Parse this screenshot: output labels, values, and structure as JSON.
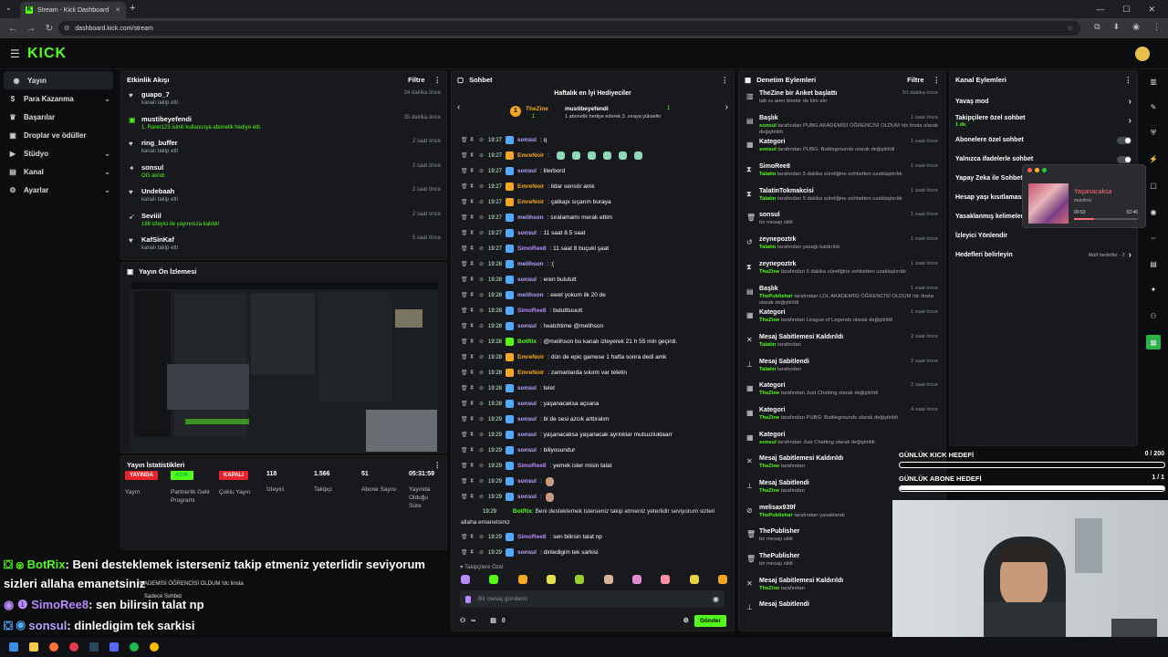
{
  "browser": {
    "tab_title": "Stream - Kick Dashboard",
    "url": "dashboard.kick.com/stream"
  },
  "brand": {
    "logo": "KICK",
    "accent": "#53fc18"
  },
  "sidebar": {
    "items": [
      {
        "label": "Yayın",
        "icon": "broadcast-icon",
        "active": true
      },
      {
        "label": "Para Kazanma",
        "icon": "dollar-icon",
        "chevron": true
      },
      {
        "label": "Başarılar",
        "icon": "trophy-icon"
      },
      {
        "label": "Droplar ve ödüller",
        "icon": "gift-icon"
      },
      {
        "label": "Stüdyo",
        "icon": "studio-icon",
        "chevron": true
      },
      {
        "label": "Kanal",
        "icon": "channel-icon",
        "chevron": true
      },
      {
        "label": "Ayarlar",
        "icon": "gear-icon",
        "chevron": true
      }
    ]
  },
  "activity": {
    "title": "Etkinlik Akışı",
    "filter": "Filtre",
    "items": [
      {
        "name": "guapo_7",
        "desc": "kanalı takip etti",
        "time": "34 dakika önce",
        "icon": "heart-icon",
        "green": false
      },
      {
        "name": "mustibeyefendi",
        "desc": "1. Rarer123 isimli kullanıcıya abonelik hediye etti.",
        "time": "35 dakika önce",
        "icon": "gift-icon",
        "green": true
      },
      {
        "name": "ring_buffer",
        "desc": "kanalı takip etti",
        "time": "2 saat önce",
        "icon": "heart-icon",
        "green": false
      },
      {
        "name": "sonsul",
        "desc": "OG alındı",
        "time": "2 saat önce",
        "icon": "drop-icon",
        "green": true
      },
      {
        "name": "Undebaah",
        "desc": "kanalı takip etti",
        "time": "2 saat önce",
        "icon": "heart-icon",
        "green": false
      },
      {
        "name": "Seviiil",
        "desc": "188 izleyici ile yayınınıza katıldı!",
        "time": "2 saat önce",
        "icon": "raid-icon",
        "green": true
      },
      {
        "name": "KafSinKaf",
        "desc": "kanalı takip etti",
        "time": "5 saat önce",
        "icon": "heart-icon",
        "green": false
      }
    ]
  },
  "preview": {
    "title": "Yayın Ön İzlemesi"
  },
  "stats": {
    "title": "Yayın İstatistikleri",
    "items": [
      {
        "value": "YAYINDA",
        "label": "Yayın",
        "pill_color": "#e8242c"
      },
      {
        "value": "ACIK",
        "label": "Partnerlik Gelir Programı",
        "pill_color": "#53fc18"
      },
      {
        "value": "KAPALI",
        "label": "Çoklu Yayın",
        "pill_color": "#e8242c"
      },
      {
        "value": "118",
        "label": "İzleyici"
      },
      {
        "value": "1.566",
        "label": "Takipçi"
      },
      {
        "value": "51",
        "label": "Abone Sayısı"
      },
      {
        "value": "05:31:59",
        "label": "Yayında Olduğu Süre"
      }
    ]
  },
  "chat": {
    "title": "Sohbet",
    "gifters_title": "Haftalık en İyi Hediyeciler",
    "top_gifter": {
      "name": "TheZine",
      "count": "1",
      "sub": "1"
    },
    "top_gifter2": {
      "name": "mustibeyefendi",
      "count": "1",
      "desc": "1 abonelik hediye ederek 3. sıraya yükselin"
    },
    "messages": [
      {
        "time": "19:27",
        "user": "sonsul",
        "color": "#b7a4ff",
        "text": "q"
      },
      {
        "time": "19:27",
        "user": "EmreNoir",
        "color": "#f5a623",
        "text": ""
      },
      {
        "time": "19:27",
        "user": "sonsul",
        "color": "#b7a4ff",
        "text": "literbord"
      },
      {
        "time": "19:27",
        "user": "EmreNoir",
        "color": "#f5a623",
        "text": "ildar sensör amk"
      },
      {
        "time": "19:27",
        "user": "EmreNoir",
        "color": "#f5a623",
        "text": "çatkapı sıçarım buraya"
      },
      {
        "time": "19:27",
        "user": "melihson",
        "color": "#b7a4ff",
        "text": "sıralamamı merak ettim"
      },
      {
        "time": "19:27",
        "user": "sonsul",
        "color": "#b7a4ff",
        "text": "11 saat 8.5 saat"
      },
      {
        "time": "19:27",
        "user": "SimoRee8",
        "color": "#b98bff",
        "text": "11 saat 8 buçukl şaat"
      },
      {
        "time": "19:28",
        "user": "melihson",
        "color": "#b7a4ff",
        "text": ":("
      },
      {
        "time": "19:28",
        "user": "sonsul",
        "color": "#b7a4ff",
        "text": "eren bulututt"
      },
      {
        "time": "19:28",
        "user": "melihson",
        "color": "#b7a4ff",
        "text": "ewet yokum ilk 20 de"
      },
      {
        "time": "19:28",
        "user": "SimoRee8",
        "color": "#b98bff",
        "text": "bulutttuuutt"
      },
      {
        "time": "19:28",
        "user": "sonsul",
        "color": "#b7a4ff",
        "text": "!watchtime @melihson"
      },
      {
        "time": "19:28",
        "user": "BotRix",
        "color": "#53fc18",
        "text": "@melihson bu kanalı izleyerek 21 h 55 min geçirdi."
      },
      {
        "time": "19:28",
        "user": "EmreNoir",
        "color": "#f5a623",
        "text": "dün de epic gamese 1 hafta sonra dedi amk"
      },
      {
        "time": "19:28",
        "user": "EmreNoir",
        "color": "#f5a623",
        "text": "zamanlarda sıkıntı var teletin"
      },
      {
        "time": "19:28",
        "user": "sonsul",
        "color": "#b7a4ff",
        "text": "telet"
      },
      {
        "time": "19:28",
        "user": "sonsul",
        "color": "#b7a4ff",
        "text": "yaşanacaksa açsana"
      },
      {
        "time": "19:29",
        "user": "sonsul",
        "color": "#b7a4ff",
        "text": "bi de sesi azcık arttıralım"
      },
      {
        "time": "19:29",
        "user": "sonsul",
        "color": "#b7a4ff",
        "text": "yaşanacaksa yaşanacak ayrılıklar mutsuzluklaarr"
      },
      {
        "time": "19:29",
        "user": "sonsul",
        "color": "#b7a4ff",
        "text": "biliyosundur"
      },
      {
        "time": "19:29",
        "user": "SimoRee8",
        "color": "#b98bff",
        "text": "yemek ister misin talat"
      },
      {
        "time": "19:29",
        "user": "sonsul",
        "color": "#b7a4ff",
        "text": ""
      },
      {
        "time": "19:29",
        "user": "sonsul",
        "color": "#b7a4ff",
        "text": ""
      }
    ],
    "botrix_long": {
      "time": "19:29",
      "user": "BotRix",
      "text": "Beni desteklemek isterseniz takip etmeniz yeterlidir seviyorum sizleri allaha emanetsiniz"
    },
    "tail": [
      {
        "time": "19:29",
        "user": "SimoRee8",
        "color": "#b98bff",
        "text": "sen bilirsin talat np"
      },
      {
        "time": "19:29",
        "user": "sonsul",
        "color": "#b7a4ff",
        "text": "dinledigim tek sarkisi"
      }
    ],
    "followers_only": "Takipçilere Özel",
    "placeholder": "Bir mesaj gönderin",
    "send": "Gönder",
    "counter_inf": "∞",
    "counter_zero": "0"
  },
  "moderation": {
    "title": "Denetim Eylemleri",
    "filter": "Filtre",
    "items": [
      {
        "title": "TheZine bir Anket başlattı",
        "desc": "talt vs aren birebir de kim alır",
        "time": "50 dakika önce",
        "icon": "poll-icon"
      },
      {
        "title": "Başlık",
        "who": "sonsul",
        "desc": "tarafından PUBG AKADEMİSİ ÖĞRENCİSİ OLDUM !dc linsta olarak değiştirildi",
        "time": "1 saat önce",
        "icon": "title-icon"
      },
      {
        "title": "Kategori",
        "who": "sonsul",
        "desc": "tarafından PUBG: Battlegrounds olarak değiştirildi",
        "time": "1 saat önce",
        "icon": "category-icon"
      },
      {
        "title": "SimoRee8",
        "who": "Talatin",
        "desc": "tarafından 5 dakika süreliğine sohbetten uzaklaştırıldı",
        "time": "1 saat önce",
        "icon": "timeout-icon"
      },
      {
        "title": "TalatinTokmakcisi",
        "who": "Talatin",
        "desc": "tarafından 5 dakika süreliğine sohbetten uzaklaştırıldı",
        "time": "1 saat önce",
        "icon": "timeout-icon"
      },
      {
        "title": "sonsul",
        "desc": "bir mesajı sildi",
        "time": "1 saat önce",
        "icon": "trash-icon"
      },
      {
        "title": "zeynepoztrk",
        "who": "Talatin",
        "desc": "tarafından yasağı kaldırıldı",
        "time": "1 saat önce",
        "icon": "unban-icon"
      },
      {
        "title": "zeynepoztrk",
        "who": "TheZine",
        "desc": "tarafından 5 dakika süreliğine sohbetten uzaklaştırıldı",
        "time": "1 saat önce",
        "icon": "timeout-icon"
      },
      {
        "title": "Başlık",
        "who": "ThePublisher",
        "desc": "tarafından LOL AKADEMİSİ ÖĞRENCİSİ OLDUM !dc linsta olarak değiştirildi",
        "time": "1 saat önce",
        "icon": "title-icon"
      },
      {
        "title": "Kategori",
        "who": "TheZine",
        "desc": "tarafından League of Legends olarak değiştirildi",
        "time": "1 saat önce",
        "icon": "category-icon"
      },
      {
        "title": "Mesaj Sabitlemesi Kaldırıldı",
        "who": "Talatin",
        "desc": "tarafından",
        "time": "2 saat önce",
        "icon": "unpin-icon"
      },
      {
        "title": "Mesaj Sabitlendi",
        "who": "Talatin",
        "desc": "tarafından",
        "time": "2 saat önce",
        "icon": "pin-icon"
      },
      {
        "title": "Kategori",
        "who": "TheZine",
        "desc": "tarafından Just Chatting olarak değiştirildi",
        "time": "2 saat önce",
        "icon": "category-icon"
      },
      {
        "title": "Kategori",
        "who": "TheZine",
        "desc": "tarafından PUBG: Battlegrounds olarak değiştirildi",
        "time": "4 saat önce",
        "icon": "category-icon"
      },
      {
        "title": "Kategori",
        "who": "sonsul",
        "desc": "tarafından Just Chatting olarak değiştirildi",
        "time": "",
        "icon": "category-icon"
      },
      {
        "title": "Mesaj Sabitlemesi Kaldırıldı",
        "who": "TheZine",
        "desc": "tarafından",
        "time": "",
        "icon": "unpin-icon"
      },
      {
        "title": "Mesaj Sabitlendi",
        "who": "TheZine",
        "desc": "tarafından",
        "time": "",
        "icon": "pin-icon"
      },
      {
        "title": "melisax939f",
        "who": "ThePublisher",
        "desc": "tarafından yasaklandı",
        "time": "",
        "icon": "ban-icon"
      },
      {
        "title": "ThePublisher",
        "desc": "bir mesajı sildi",
        "time": "",
        "icon": "trash-icon"
      },
      {
        "title": "ThePublisher",
        "desc": "bir mesajı sildi",
        "time": "",
        "icon": "trash-icon"
      },
      {
        "title": "Mesaj Sabitlemesi Kaldırıldı",
        "who": "TheZine",
        "desc": "tarafından",
        "time": "",
        "icon": "unpin-icon"
      },
      {
        "title": "Mesaj Sabitlendi",
        "who": "",
        "desc": "",
        "time": "",
        "icon": "pin-icon"
      }
    ]
  },
  "channel_actions": {
    "title": "Kanal Eylemleri",
    "items": [
      {
        "label": "Yavaş mod",
        "type": "chevron"
      },
      {
        "label": "Takipçilere özel sohbet",
        "sub": "1 dk.",
        "type": "chevron"
      },
      {
        "label": "Abonelere özel sohbet",
        "type": "toggle"
      },
      {
        "label": "Yalnızca ifadelerle sohbet",
        "type": "toggle"
      },
      {
        "label": "Yapay Zeka ile Sohbet",
        "type": "none"
      },
      {
        "label": "Hesap yaşı kısıtlaması",
        "type": "none"
      },
      {
        "label": "Yasaklanmış kelimeler",
        "type": "none"
      },
      {
        "label": "İzleyici Yönlendir",
        "type": "none"
      },
      {
        "label": "Hedefleri belirleyin",
        "type": "chevron",
        "extra": "Aktif hedefler - 2"
      }
    ]
  },
  "music": {
    "title": "Yaşanacaksa",
    "artist": "manifest",
    "elapsed": "00:53",
    "total": "02:46",
    "progress": 0.32
  },
  "goals": [
    {
      "label": "GÜNLÜK KICK HEDEFİ",
      "value": "0 / 200",
      "progress": 0.0
    },
    {
      "label": "GÜNLÜK ABONE HEDEFİ",
      "value": "1 / 1",
      "progress": 1.0
    }
  ],
  "overlay": {
    "line1_user": "BotRix",
    "line1_text": ": Beni desteklemek isterseniz takip etmeniz yeterlidir seviyorum",
    "line2_text": "sizleri allaha emanetsiniz",
    "line3_user": "SimoRee8",
    "line3_text": ": sen bilirsin talat np",
    "line4_user": "sonsul",
    "line4_text": ": dinledigim tek sarkisi",
    "ghost1": "AKADEMİSİ ÖĞRENCİSİ OLDUM !dc linsta",
    "ghost2": "Sadece Sohbet"
  }
}
